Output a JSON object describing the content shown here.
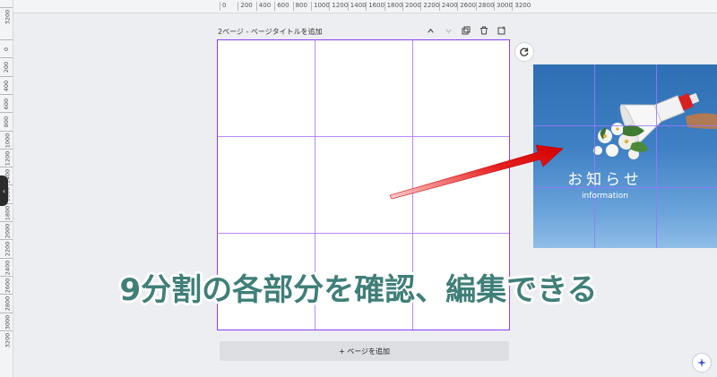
{
  "ruler_top": [
    "0",
    "200",
    "400",
    "600",
    "800",
    "1000",
    "1200",
    "1400",
    "1600",
    "1800",
    "2000",
    "2200",
    "2400",
    "2600",
    "2800",
    "3000",
    "3200"
  ],
  "ruler_left": [
    "3200",
    "0",
    "200",
    "400",
    "600",
    "800",
    "1000",
    "1200",
    "1400",
    "1600",
    "1800",
    "2000",
    "2200",
    "2400",
    "2600",
    "2800",
    "3000",
    "3200"
  ],
  "page_header": {
    "title": "2ページ - ページタイトルを追加",
    "icons": [
      "chevron-up-icon",
      "chevron-down-icon",
      "duplicate-icon",
      "trash-icon",
      "add-page-icon"
    ]
  },
  "canvas": {
    "accent": "#8b3dff"
  },
  "add_page_label": "+ ページを追加",
  "sample": {
    "title": "お知らせ",
    "subtitle": "information"
  },
  "caption": "9分割の各部分を確認、編集できる",
  "colors": {
    "caption": "#3f7f78",
    "arrow": "#e01010",
    "grid": "#b889ff"
  }
}
